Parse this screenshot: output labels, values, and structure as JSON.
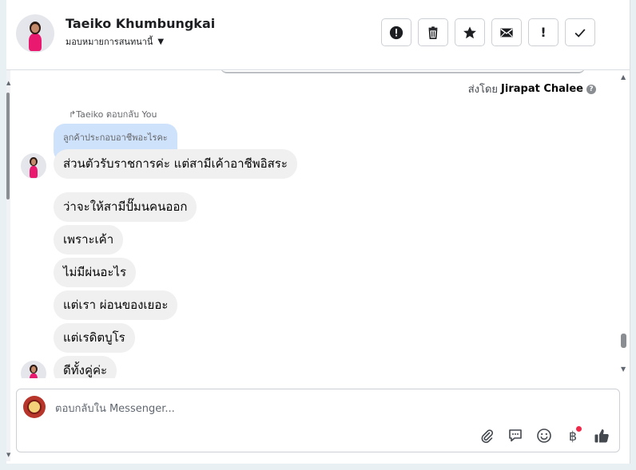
{
  "contact": {
    "name": "Taeiko Khumbungkai",
    "assign_label": "มอบหมายการสนทนานี้"
  },
  "actions": [
    {
      "id": "spam",
      "icon": "alert-circle-icon"
    },
    {
      "id": "delete",
      "icon": "trash-icon"
    },
    {
      "id": "star",
      "icon": "star-icon"
    },
    {
      "id": "mark-unread",
      "icon": "envelope-icon"
    },
    {
      "id": "follow-up",
      "icon": "exclamation-icon",
      "glyph": "!"
    },
    {
      "id": "done",
      "icon": "check-icon"
    }
  ],
  "conversation": {
    "sent_by_prefix": "ส่งโดย",
    "sent_by_name": "Jirapat Chalee",
    "help_glyph": "?",
    "reply_note": "Taeiko ตอบกลับ You",
    "quoted_text": "ลูกค้าประกอบอาชีพอะไรคะ",
    "messages": [
      "ส่วนตัวรับราชการค่ะ แต่สามีเค้าอาชีพอิสระ",
      "ว่าจะให้สามีปั๊มนคนออก",
      "เพราะเค้า",
      "ไม่มีผ่นอะไร",
      "แต่เรา ผ่อนของเยอะ",
      "แต่เรดิตบูโร",
      "ดีทั้งคู่ค่ะ"
    ]
  },
  "composer": {
    "placeholder": "ตอบกลับใน Messenger...",
    "value": "",
    "baht_glyph": "฿",
    "tools": [
      "paperclip-icon",
      "saved-reply-icon",
      "emoji-icon",
      "payment-icon",
      "like-icon"
    ]
  },
  "colors": {
    "bubble": "#f0f0f0",
    "quoted": "#cfe2fb",
    "notification_dot": "#f02849"
  }
}
